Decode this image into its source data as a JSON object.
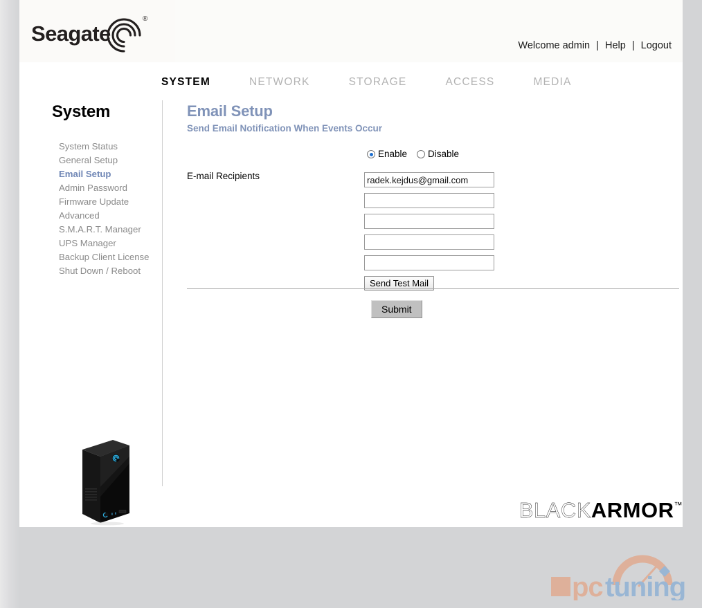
{
  "header": {
    "brand": "Seagate",
    "brand_reg": "®",
    "welcome": "Welcome admin",
    "sep1": "|",
    "help": "Help",
    "sep2": "|",
    "logout": "Logout"
  },
  "topnav": {
    "items": [
      {
        "label": "SYSTEM",
        "active": true
      },
      {
        "label": "NETWORK",
        "active": false
      },
      {
        "label": "STORAGE",
        "active": false
      },
      {
        "label": "ACCESS",
        "active": false
      },
      {
        "label": "MEDIA",
        "active": false
      }
    ]
  },
  "sidebar": {
    "title": "System",
    "items": [
      {
        "label": "System Status",
        "active": false
      },
      {
        "label": "General Setup",
        "active": false
      },
      {
        "label": "Email Setup",
        "active": true
      },
      {
        "label": "Admin Password",
        "active": false
      },
      {
        "label": "Firmware Update",
        "active": false
      },
      {
        "label": "Advanced",
        "active": false
      },
      {
        "label": "S.M.A.R.T. Manager",
        "active": false
      },
      {
        "label": "UPS Manager",
        "active": false
      },
      {
        "label": "Backup Client License",
        "active": false
      },
      {
        "label": "Shut Down / Reboot",
        "active": false
      }
    ]
  },
  "content": {
    "title": "Email Setup",
    "subtitle": "Send Email Notification When Events Occur",
    "radio": {
      "enable_label": "Enable",
      "disable_label": "Disable",
      "selected": "Enable"
    },
    "recipients_label": "E-mail Recipients",
    "recipients": [
      {
        "value": "radek.kejdus@gmail.com",
        "placeholder": ""
      },
      {
        "value": "",
        "placeholder": ""
      },
      {
        "value": "",
        "placeholder": ""
      },
      {
        "value": "",
        "placeholder": ""
      },
      {
        "value": "",
        "placeholder": ""
      }
    ],
    "send_test_mail_label": "Send Test Mail",
    "submit_label": "Submit"
  },
  "footer": {
    "brand_light": "BLACK",
    "brand_bold": "ARMOR",
    "brand_tm": "™"
  },
  "watermark": {
    "text_pc": "pc",
    "text_tuning": "tuning"
  },
  "colors": {
    "accent_blue": "#8093b8",
    "active_nav": "#000000",
    "inactive_nav": "#b3b3b3",
    "sidebar_text": "#8a8a8a",
    "sidebar_active": "#6f86b5",
    "radio_selected": "#1d6fd0",
    "page_bg": "#ffffff",
    "frame_bg": "#d3d4d6",
    "header_bg": "#fbfbf9",
    "watermark_orange": "#e8936a",
    "watermark_blue": "#6b9fd4",
    "seagate_logo_blue": "#2aa7d8"
  }
}
